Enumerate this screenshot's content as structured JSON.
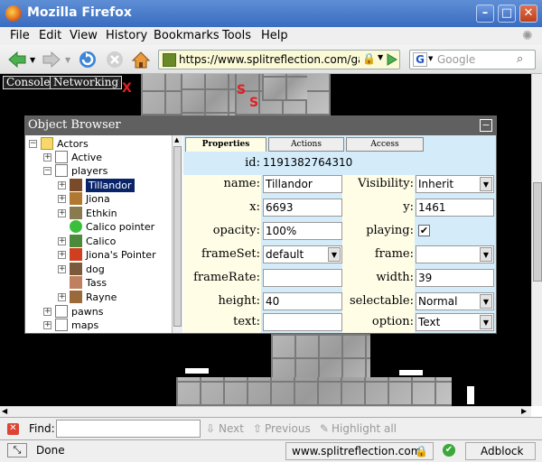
{
  "window": {
    "title": "Mozilla Firefox"
  },
  "menu": [
    "File",
    "Edit",
    "View",
    "History",
    "Bookmarks",
    "Tools",
    "Help"
  ],
  "toolbar": {
    "url": "https://www.splitreflection.com/ga",
    "search_placeholder": "Google"
  },
  "devtools": {
    "tabs": [
      "Console",
      "Networking"
    ]
  },
  "object_browser": {
    "title": "Object Browser",
    "tree": [
      {
        "label": "Actors",
        "level": 0,
        "toggle": "−",
        "icon": "folder"
      },
      {
        "label": "Active",
        "level": 1,
        "toggle": "+",
        "icon": "doc"
      },
      {
        "label": "players",
        "level": 1,
        "toggle": "−",
        "icon": "doc"
      },
      {
        "label": "Tillandor",
        "level": 2,
        "toggle": "+",
        "icon": "sprite",
        "selected": true
      },
      {
        "label": "Jiona",
        "level": 2,
        "toggle": "+",
        "icon": "sprite"
      },
      {
        "label": "Ethkin",
        "level": 2,
        "toggle": "+",
        "icon": "sprite"
      },
      {
        "label": "Calico pointer",
        "level": 2,
        "toggle": "",
        "icon": "sprite"
      },
      {
        "label": "Calico",
        "level": 2,
        "toggle": "+",
        "icon": "sprite"
      },
      {
        "label": "Jiona's Pointer",
        "level": 2,
        "toggle": "+",
        "icon": "sprite"
      },
      {
        "label": "dog",
        "level": 2,
        "toggle": "+",
        "icon": "sprite"
      },
      {
        "label": "Tass",
        "level": 2,
        "toggle": "",
        "icon": "sprite"
      },
      {
        "label": "Rayne",
        "level": 2,
        "toggle": "+",
        "icon": "sprite"
      },
      {
        "label": "pawns",
        "level": 1,
        "toggle": "+",
        "icon": "doc"
      },
      {
        "label": "maps",
        "level": 1,
        "toggle": "+",
        "icon": "doc"
      }
    ],
    "tabs": [
      "Properties",
      "Actions",
      "Access"
    ],
    "props": {
      "id_label": "id:",
      "id": "1191382764310",
      "name_label": "name:",
      "name": "Tillandor",
      "visibility_label": "Visibility:",
      "visibility": "Inherit",
      "x_label": "x:",
      "x": "6693",
      "y_label": "y:",
      "y": "1461",
      "opacity_label": "opacity:",
      "opacity": "100%",
      "playing_label": "playing:",
      "playing": "✔",
      "frameset_label": "frameSet:",
      "frameset": "default",
      "frame_label": "frame:",
      "frame": "",
      "framerate_label": "frameRate:",
      "framerate": "",
      "width_label": "width:",
      "width": "39",
      "height_label": "height:",
      "height": "40",
      "selectable_label": "selectable:",
      "selectable": "Normal",
      "text_label": "text:",
      "text": "",
      "option_label": "option:",
      "option": "Text"
    }
  },
  "findbar": {
    "label": "Find:",
    "next": "Next",
    "previous": "Previous",
    "highlight": "Highlight all"
  },
  "status": {
    "text": "Done",
    "host": "www.splitreflection.com",
    "adblock": "Adblock"
  }
}
